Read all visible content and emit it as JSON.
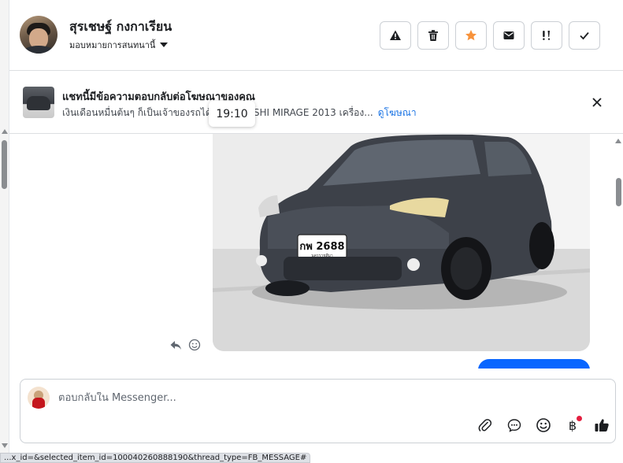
{
  "header": {
    "contact_name": "สุรเชษฐ์ กงกาเรียน",
    "assign_label": "มอบหมายการสนทนานี้"
  },
  "actions": [
    {
      "name": "report-button",
      "icon": "warning-icon"
    },
    {
      "name": "delete-button",
      "icon": "trash-icon"
    },
    {
      "name": "star-button",
      "icon": "star-icon",
      "color": "#f7923b"
    },
    {
      "name": "mark-unread-button",
      "icon": "envelope-icon"
    },
    {
      "name": "mark-spam-button",
      "icon": "exclamation-icon"
    },
    {
      "name": "mark-done-button",
      "icon": "check-icon"
    }
  ],
  "ad_banner": {
    "title": "แชทนี้มีข้อความตอบกลับต่อโฆษณาของคุณ",
    "subtitle": "เงินเดือนหมื่นต้นๆ ก็เป็นเจ้าของรถได้ MITSUBISHI MIRAGE 2013 เครื่อง...",
    "link_label": "ดูโฆษณา"
  },
  "tooltip": {
    "time": "19:10"
  },
  "message": {
    "photo_alt": "รูปภาพรถยนต์",
    "plate": "กพ 2688",
    "plate_province": "นครราชสีมา"
  },
  "composer": {
    "placeholder": "ตอบกลับใน Messenger...",
    "tools": [
      "attach-icon",
      "saved-reply-icon",
      "emoji-icon",
      "baht-icon",
      "like-icon"
    ]
  },
  "status_url": "...x_id=&selected_item_id=100040260888190&thread_type=FB_MESSAGE#",
  "colors": {
    "accent": "#0866ff",
    "link": "#1b74e4",
    "star": "#f7923b"
  }
}
